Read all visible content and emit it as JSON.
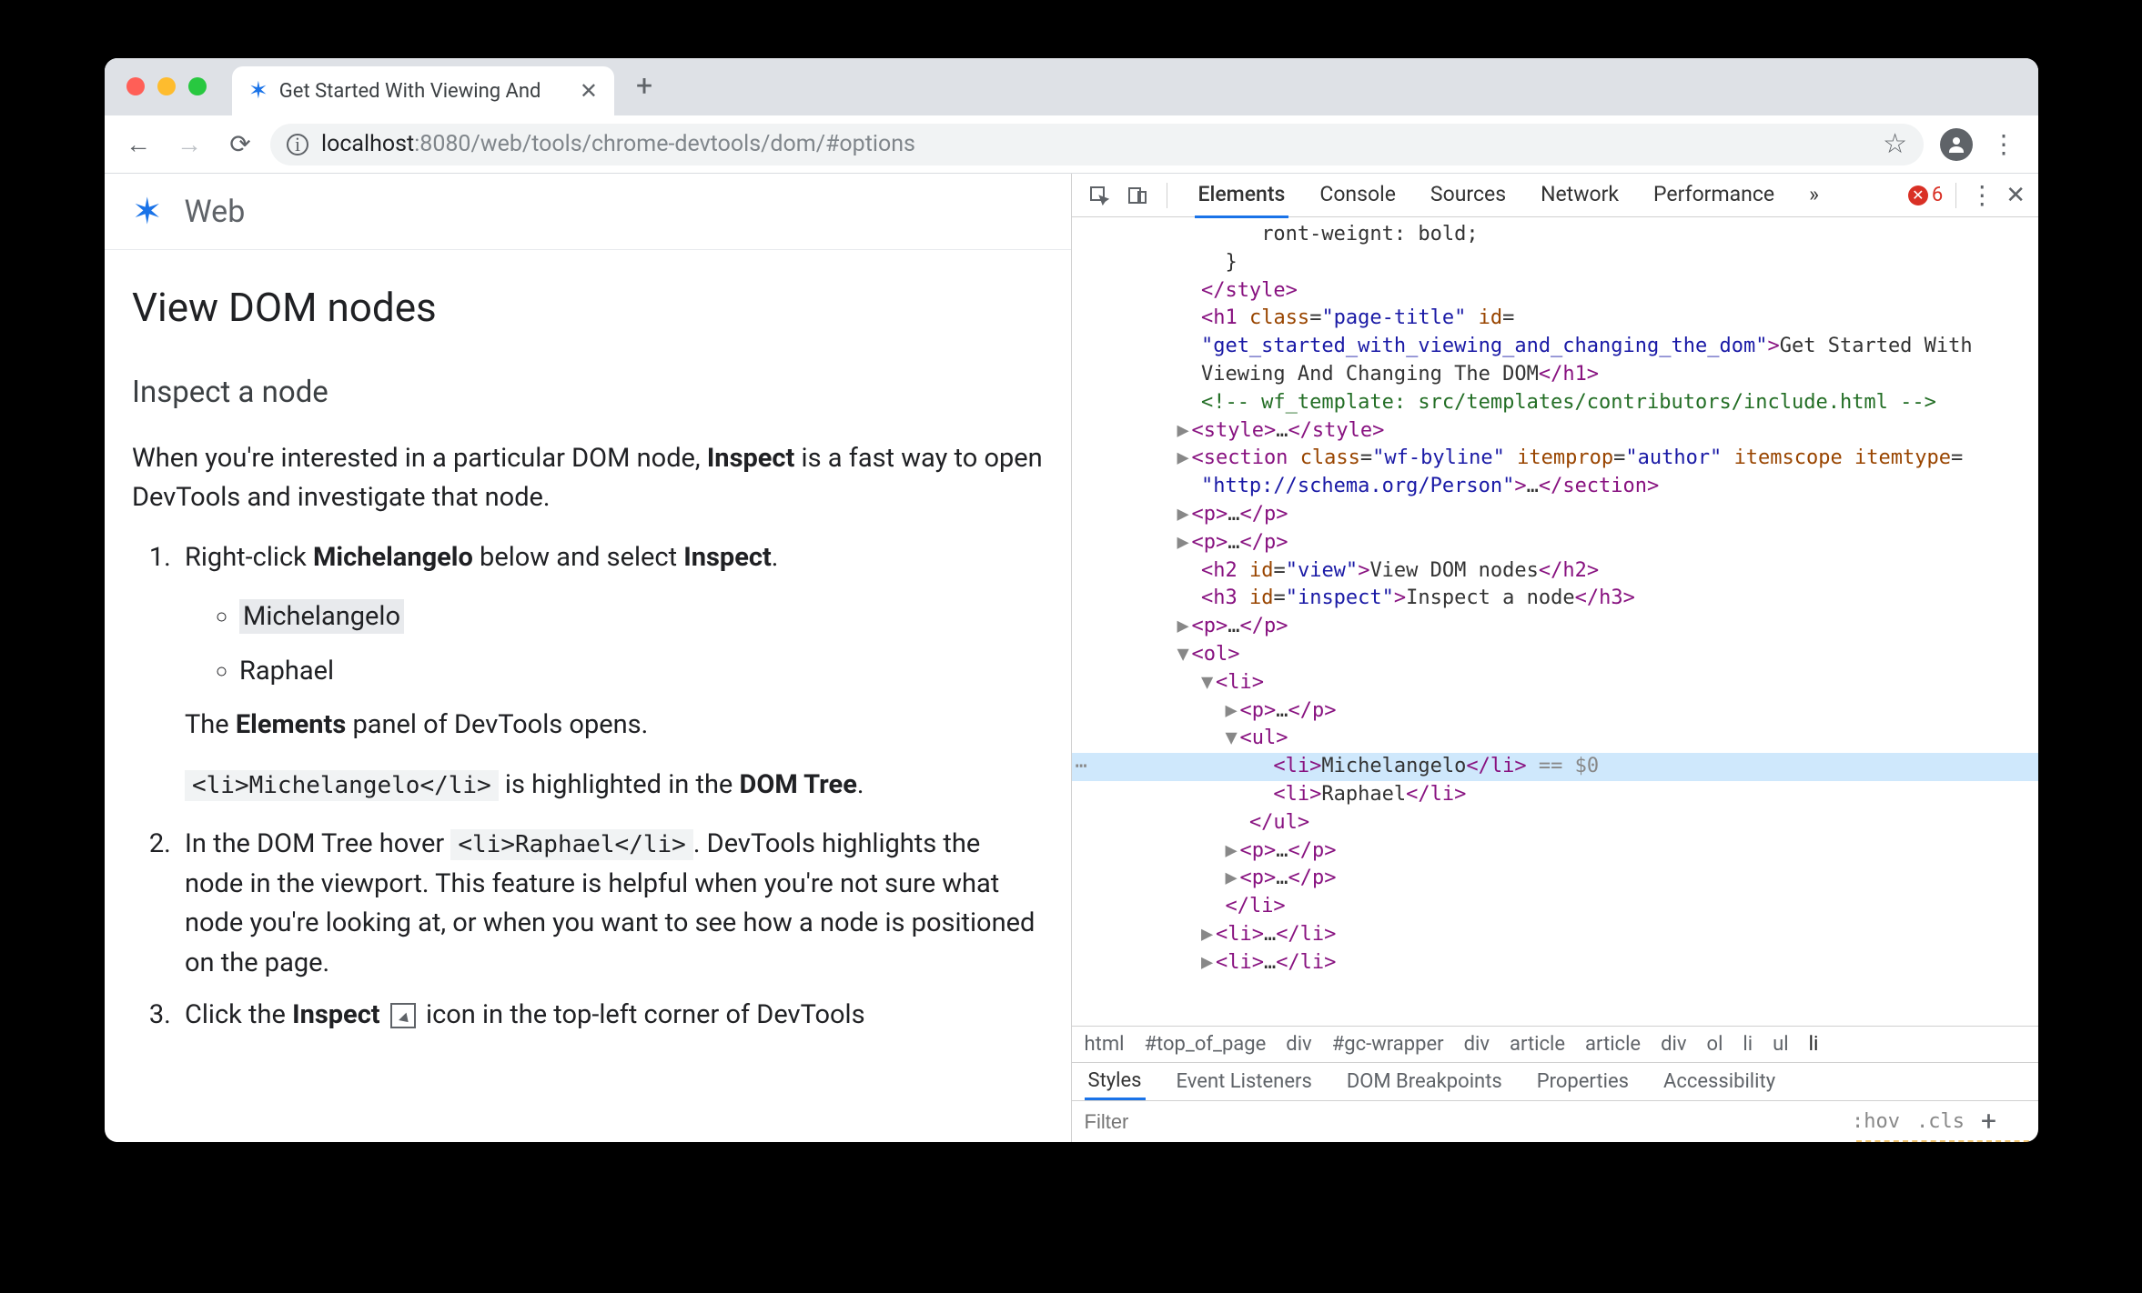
{
  "browser": {
    "tab_title": "Get Started With Viewing And",
    "url_host": "localhost",
    "url_port": ":8080",
    "url_path": "/web/tools/chrome-devtools/dom/#options"
  },
  "page": {
    "site_name": "Web",
    "h2": "View DOM nodes",
    "h3": "Inspect a node",
    "intro_pre": "When you're interested in a particular DOM node, ",
    "intro_strong": "Inspect",
    "intro_post": " is a fast way to open DevTools and investigate that node.",
    "step1_pre": "Right-click ",
    "step1_strong": "Michelangelo",
    "step1_mid": " below and select ",
    "step1_strong2": "Inspect",
    "step1_post": ".",
    "bullets": [
      "Michelangelo",
      "Raphael"
    ],
    "step1_after_pre": "The ",
    "step1_after_strong": "Elements",
    "step1_after_post": " panel of DevTools opens.",
    "step1_code": "<li>Michelangelo</li>",
    "step1_hl_mid": " is highlighted in the ",
    "step1_hl_strong": "DOM Tree",
    "step1_hl_post": ".",
    "step2_pre": "In the DOM Tree hover ",
    "step2_code": "<li>Raphael</li>",
    "step2_post": ". DevTools highlights the node in the viewport. This feature is helpful when you're not sure what node you're looking at, or when you want to see how a node is positioned on the page.",
    "step3_pre": "Click the ",
    "step3_strong": "Inspect",
    "step3_post": " icon in the top-left corner of DevTools"
  },
  "devtools": {
    "tabs": [
      "Elements",
      "Console",
      "Sources",
      "Network",
      "Performance"
    ],
    "more": "»",
    "error_count": "6",
    "code_lines": [
      {
        "i": 15,
        "h": "               <span class='txt'>ront-weignt: bold;</span>"
      },
      {
        "i": 12,
        "h": "            <span class='txt'>}</span>"
      },
      {
        "i": 10,
        "h": "          <span class='tag'>&lt;/style&gt;</span>"
      },
      {
        "i": 10,
        "h": "          <span class='tag'>&lt;h1</span> <span class='attr'>class</span>=<span class='val'>\"page-title\"</span> <span class='attr'>id</span>="
      },
      {
        "i": 10,
        "h": "          <span class='val'>\"get_started_with_viewing_and_changing_the_dom\"</span><span class='tag'>&gt;</span><span class='txt'>Get Started With</span>"
      },
      {
        "i": 10,
        "h": "          <span class='txt'>Viewing And Changing The DOM</span><span class='tag'>&lt;/h1&gt;</span>"
      },
      {
        "i": 10,
        "h": "          <span class='cmt'>&lt;!-- wf_template: src/templates/contributors/include.html --&gt;</span>"
      },
      {
        "i": 8,
        "h": "        <span class='tri'>▶</span><span class='tag'>&lt;style&gt;</span><span class='txt'>…</span><span class='tag'>&lt;/style&gt;</span>"
      },
      {
        "i": 8,
        "h": "        <span class='tri'>▶</span><span class='tag'>&lt;section</span> <span class='attr'>class</span>=<span class='val'>\"wf-byline\"</span> <span class='attr'>itemprop</span>=<span class='val'>\"author\"</span> <span class='attr'>itemscope itemtype</span>="
      },
      {
        "i": 10,
        "h": "          <span class='val'>\"http://schema.org/Person\"</span><span class='tag'>&gt;</span><span class='txt'>…</span><span class='tag'>&lt;/section&gt;</span>"
      },
      {
        "i": 8,
        "h": "        <span class='tri'>▶</span><span class='tag'>&lt;p&gt;</span><span class='txt'>…</span><span class='tag'>&lt;/p&gt;</span>"
      },
      {
        "i": 8,
        "h": "        <span class='tri'>▶</span><span class='tag'>&lt;p&gt;</span><span class='txt'>…</span><span class='tag'>&lt;/p&gt;</span>"
      },
      {
        "i": 10,
        "h": "          <span class='tag'>&lt;h2</span> <span class='attr'>id</span>=<span class='val'>\"view\"</span><span class='tag'>&gt;</span><span class='txt'>View DOM nodes</span><span class='tag'>&lt;/h2&gt;</span>"
      },
      {
        "i": 10,
        "h": "          <span class='tag'>&lt;h3</span> <span class='attr'>id</span>=<span class='val'>\"inspect\"</span><span class='tag'>&gt;</span><span class='txt'>Inspect a node</span><span class='tag'>&lt;/h3&gt;</span>"
      },
      {
        "i": 8,
        "h": "        <span class='tri'>▶</span><span class='tag'>&lt;p&gt;</span><span class='txt'>…</span><span class='tag'>&lt;/p&gt;</span>"
      },
      {
        "i": 8,
        "h": "        <span class='tri'>▼</span><span class='tag'>&lt;ol&gt;</span>"
      },
      {
        "i": 10,
        "h": "          <span class='tri'>▼</span><span class='tag'>&lt;li&gt;</span>"
      },
      {
        "i": 12,
        "h": "            <span class='tri'>▶</span><span class='tag'>&lt;p&gt;</span><span class='txt'>…</span><span class='tag'>&lt;/p&gt;</span>"
      },
      {
        "i": 12,
        "h": "            <span class='tri'>▼</span><span class='tag'>&lt;ul&gt;</span>"
      },
      {
        "i": 16,
        "sel": true,
        "h": "                <span class='tag'>&lt;li&gt;</span><span class='txt'>Michelangelo</span><span class='tag'>&lt;/li&gt;</span> <span class='sel-suffix'>== $0</span>"
      },
      {
        "i": 16,
        "h": "                <span class='tag'>&lt;li&gt;</span><span class='txt'>Raphael</span><span class='tag'>&lt;/li&gt;</span>"
      },
      {
        "i": 14,
        "h": "              <span class='tag'>&lt;/ul&gt;</span>"
      },
      {
        "i": 12,
        "h": "            <span class='tri'>▶</span><span class='tag'>&lt;p&gt;</span><span class='txt'>…</span><span class='tag'>&lt;/p&gt;</span>"
      },
      {
        "i": 12,
        "h": "            <span class='tri'>▶</span><span class='tag'>&lt;p&gt;</span><span class='txt'>…</span><span class='tag'>&lt;/p&gt;</span>"
      },
      {
        "i": 12,
        "h": "            <span class='tag'>&lt;/li&gt;</span>"
      },
      {
        "i": 10,
        "h": "          <span class='tri'>▶</span><span class='tag'>&lt;li&gt;</span><span class='txt'>…</span><span class='tag'>&lt;/li&gt;</span>"
      },
      {
        "i": 10,
        "h": "          <span class='tri'>▶</span><span class='tag'>&lt;li&gt;</span><span class='txt'>…</span><span class='tag'>&lt;/li&gt;</span>"
      }
    ],
    "crumbs": [
      "html",
      "#top_of_page",
      "div",
      "#gc-wrapper",
      "div",
      "article",
      "article",
      "div",
      "ol",
      "li",
      "ul",
      "li"
    ],
    "sub_tabs": [
      "Styles",
      "Event Listeners",
      "DOM Breakpoints",
      "Properties",
      "Accessibility"
    ],
    "filter_placeholder": "Filter",
    "hov": ":hov",
    "cls": ".cls"
  }
}
